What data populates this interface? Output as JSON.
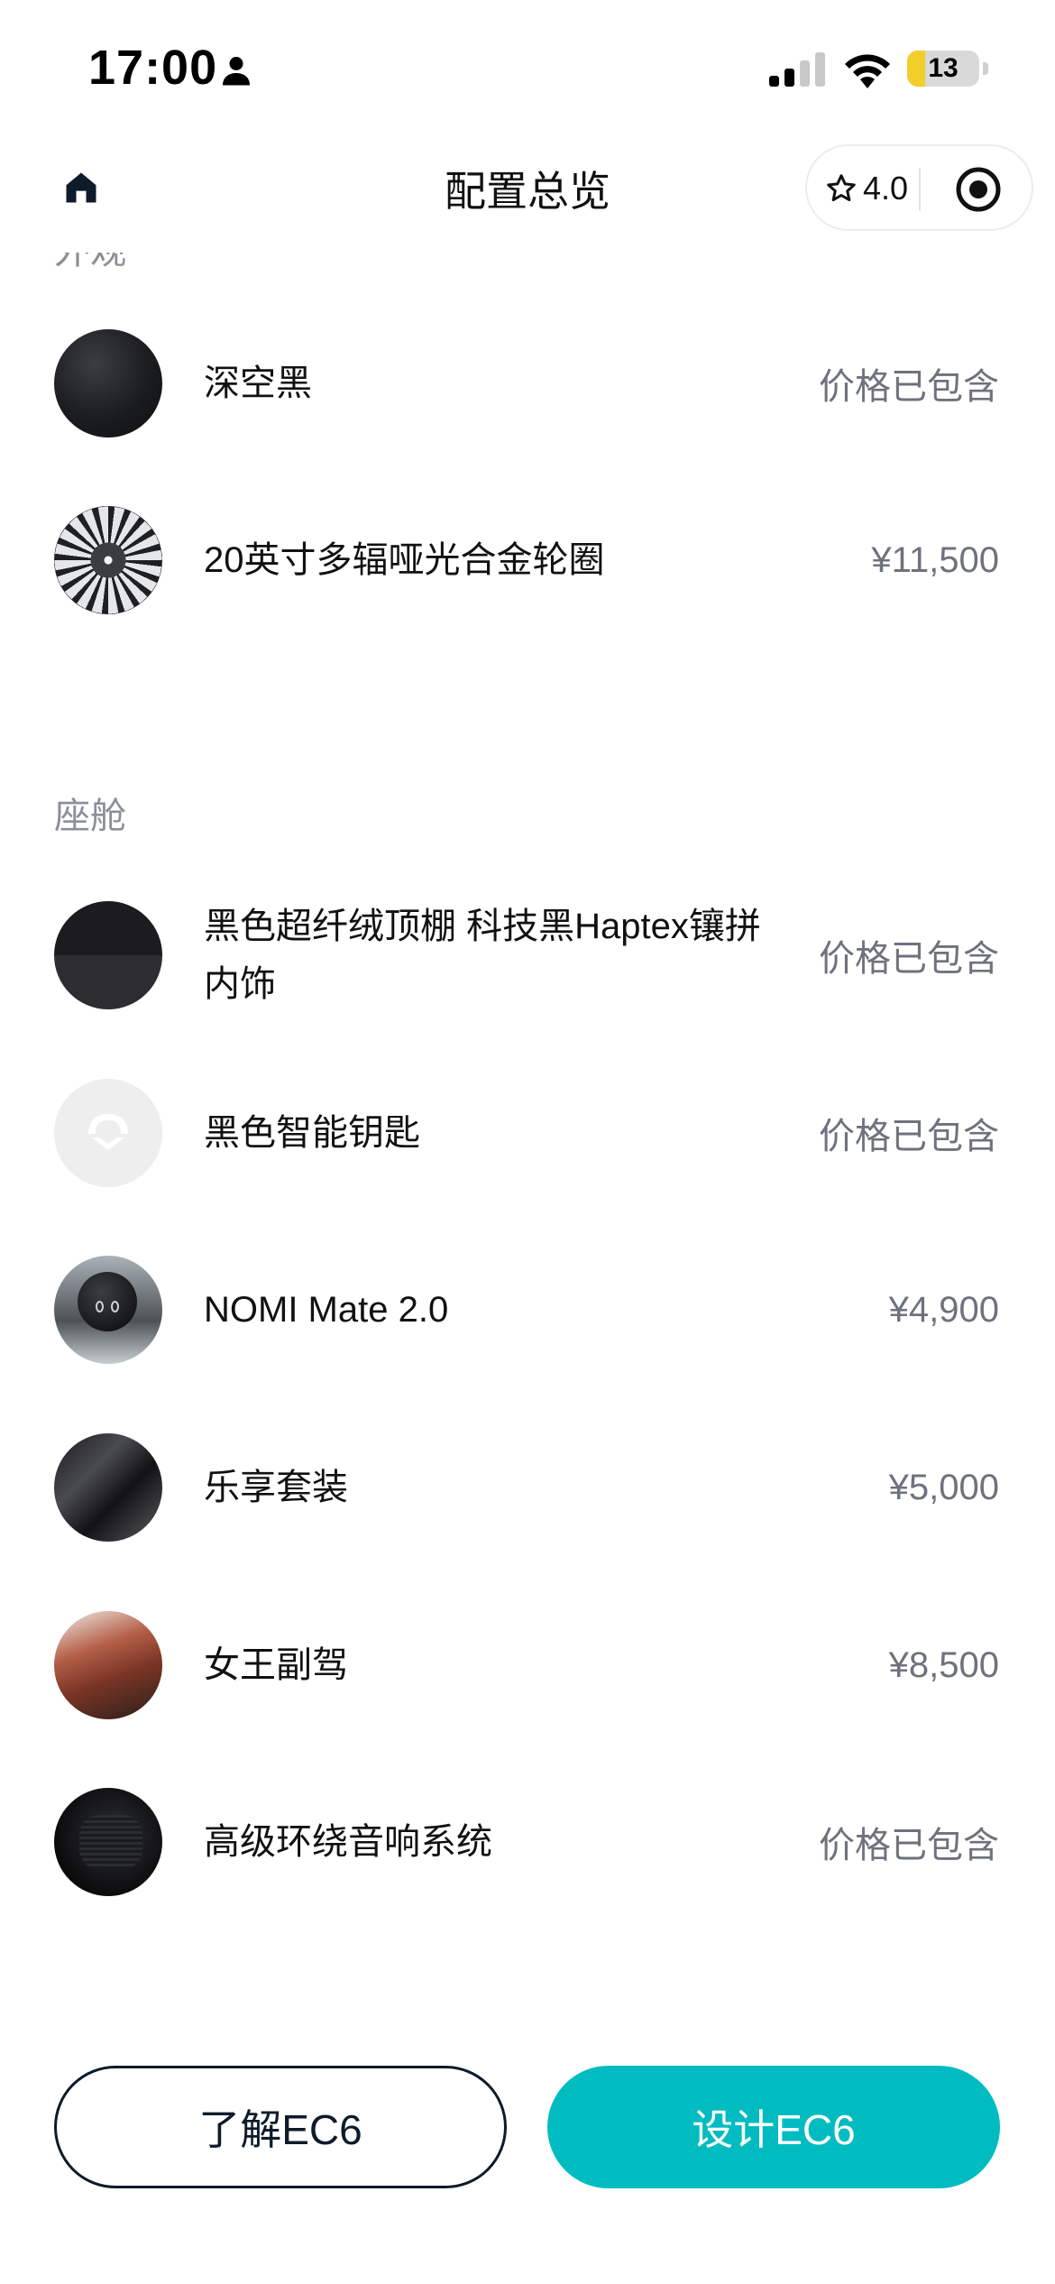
{
  "status_bar": {
    "time": "17:00",
    "battery": "13",
    "battery_level": 0.13,
    "icons": [
      "person-icon",
      "cellular-signal-icon",
      "wifi-icon",
      "battery-icon"
    ]
  },
  "nav": {
    "title": "配置总览",
    "rating": "4.0",
    "icons": [
      "home-icon",
      "star-icon",
      "target-icon"
    ]
  },
  "sections": [
    {
      "title": "外观",
      "items": [
        {
          "name": "深空黑",
          "price": "价格已包含"
        },
        {
          "name": "20英寸多辐哑光合金轮圈",
          "price": "¥11,500"
        }
      ]
    },
    {
      "title": "座舱",
      "items": [
        {
          "name": "黑色超纤绒顶棚 科技黑Haptex镶拼内饰",
          "price": "价格已包含"
        },
        {
          "name": "黑色智能钥匙",
          "price": "价格已包含"
        },
        {
          "name": "NOMI Mate 2.0",
          "price": "¥4,900"
        },
        {
          "name": "乐享套装",
          "price": "¥5,000"
        },
        {
          "name": "女王副驾",
          "price": "¥8,500"
        },
        {
          "name": "高级环绕音响系统",
          "price": "价格已包含"
        }
      ]
    }
  ],
  "buttons": {
    "learn": "了解EC6",
    "design": "设计EC6"
  },
  "colors": {
    "accent": "#00bcc0",
    "navy": "#0d1b2a",
    "secondary_text": "#6e727c",
    "section_title": "#8b8f99",
    "battery": "#f3cd2a"
  }
}
